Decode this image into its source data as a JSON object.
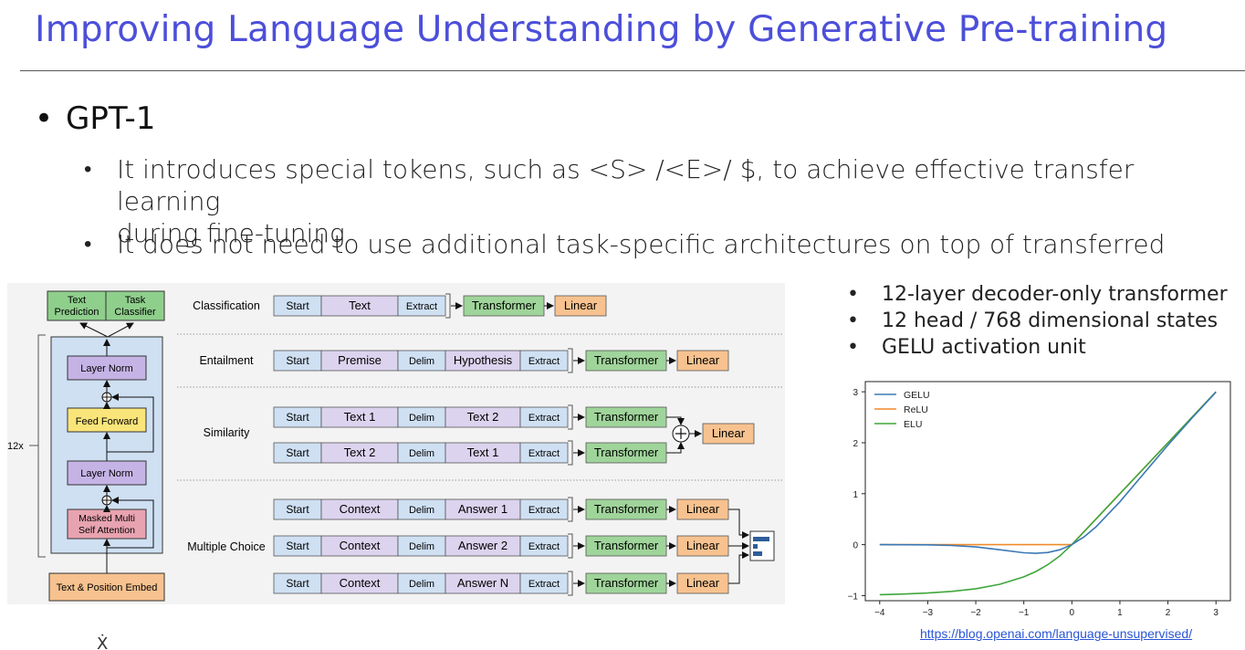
{
  "slide": {
    "title": "Improving Language Understanding by Generative Pre-training",
    "bullet": "GPT-1",
    "sub_bullets": [
      {
        "lines": [
          "It introduces special tokens, such as <S> /<E>/ $, to achieve effective transfer learning",
          "during fine-tuning"
        ]
      },
      {
        "lines": [
          "It does not need to use additional task-specific architectures on top of transferred"
        ]
      }
    ],
    "side_bullets": [
      "12-layer decoder-only transformer",
      "12 head / 768 dimensional states",
      "GELU activation unit"
    ],
    "link": "https://blog.openai.com/language-unsupervised/",
    "stray_glyph": "Ẋ"
  },
  "architecture": {
    "heads": [
      "Text",
      "Prediction",
      "Task",
      "Classifier"
    ],
    "repeat": "12x",
    "blocks": [
      "Layer Norm",
      "Feed Forward",
      "Layer Norm",
      "Masked Multi",
      "Self Attention"
    ],
    "embed": "Text & Position Embed",
    "colors": {
      "head": "#8fcf8c",
      "norm": "#c6b3e6",
      "ff": "#fae57a",
      "attn": "#e8a3b0",
      "embed": "#f7c28f",
      "stack": "#cfe0f3"
    }
  },
  "tasks": {
    "names": [
      "Classification",
      "Entailment",
      "Similarity",
      "Multiple Choice"
    ],
    "tokens": {
      "start": "Start",
      "extract": "Extract",
      "delim": "Delim",
      "text": "Text",
      "premise": "Premise",
      "hypothesis": "Hypothesis",
      "text1": "Text 1",
      "text2": "Text 2",
      "context": "Context",
      "answer1": "Answer 1",
      "answer2": "Answer 2",
      "answerN": "Answer N"
    },
    "transformer": "Transformer",
    "linear": "Linear",
    "colors": {
      "start": "#cfe0f3",
      "text": "#dcd3ee",
      "transformer": "#9fd49a",
      "linear": "#f7c28f"
    }
  },
  "chart_data": {
    "type": "line",
    "series": [
      {
        "name": "GELU",
        "color": "#3b78b5",
        "x": [
          -4,
          -3.5,
          -3,
          -2.5,
          -2,
          -1.5,
          -1,
          -0.75,
          -0.5,
          -0.25,
          0,
          0.25,
          0.5,
          1,
          1.5,
          2,
          2.5,
          3
        ],
        "y": [
          0,
          -0.001,
          -0.004,
          -0.016,
          -0.045,
          -0.1,
          -0.159,
          -0.17,
          -0.154,
          -0.1,
          0,
          0.15,
          0.346,
          0.841,
          1.4,
          1.955,
          2.484,
          2.996
        ]
      },
      {
        "name": "ReLU",
        "color": "#f08a2c",
        "x": [
          -4,
          0,
          3
        ],
        "y": [
          0,
          0,
          3
        ]
      },
      {
        "name": "ELU",
        "color": "#3fa63b",
        "x": [
          -4,
          -3.5,
          -3,
          -2.5,
          -2,
          -1.5,
          -1,
          -0.75,
          -0.5,
          -0.25,
          0,
          1,
          2,
          3
        ],
        "y": [
          -0.982,
          -0.97,
          -0.95,
          -0.918,
          -0.865,
          -0.777,
          -0.632,
          -0.528,
          -0.393,
          -0.221,
          0,
          1,
          2,
          3
        ]
      }
    ],
    "xlim": [
      -4.3,
      3.3
    ],
    "ylim": [
      -1.1,
      3.2
    ],
    "xticks": [
      "−4",
      "−3",
      "−2",
      "−1",
      "0",
      "1",
      "2",
      "3"
    ],
    "yticks": [
      "−1",
      "0",
      "1",
      "2",
      "3"
    ],
    "legend": "top-left",
    "grid": false
  }
}
